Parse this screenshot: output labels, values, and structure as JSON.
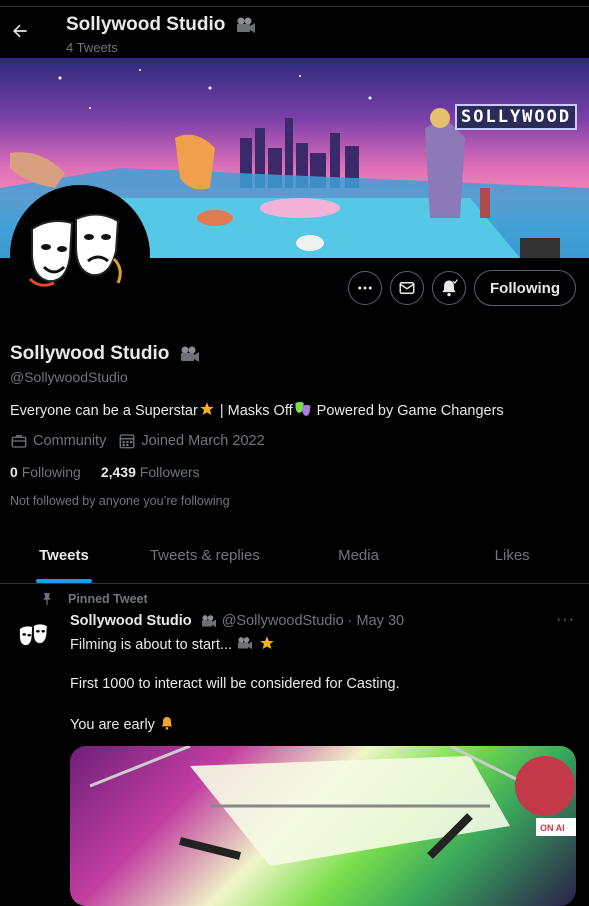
{
  "header": {
    "title": "Sollywood Studio",
    "tweet_count": "4 Tweets"
  },
  "banner": {
    "sign_text": "SOLLYWOOD"
  },
  "profile": {
    "name": "Sollywood Studio",
    "handle": "@SollywoodStudio",
    "bio_part1": "Everyone can be a Superstar",
    "bio_part2": " | Masks Off",
    "bio_part3": " Powered by Game Changers",
    "category": "Community",
    "joined": "Joined March 2022",
    "following_count": "0",
    "following_label": "Following",
    "followers_count": "2,439",
    "followers_label": "Followers",
    "note": "Not followed by anyone you’re following",
    "follow_button": "Following"
  },
  "tabs": [
    "Tweets",
    "Tweets & replies",
    "Media",
    "Likes"
  ],
  "tweet": {
    "pinned_label": "Pinned Tweet",
    "author": "Sollywood Studio",
    "handle": "@SollywoodStudio",
    "date": "· May 30",
    "line1": "Filming is about to start...",
    "line2": "First 1000 to interact will be considered for Casting.",
    "line3": "You are early"
  },
  "colors": {
    "accent": "#1d9bf0",
    "background": "#000000",
    "text": "#e7e9ea",
    "muted": "#71767b",
    "border": "#536471"
  },
  "icons": [
    "back-arrow-icon",
    "camera-icon",
    "more-icon",
    "mail-icon",
    "bell-icon",
    "briefcase-icon",
    "calendar-icon",
    "pin-icon",
    "star-icon",
    "mask-icon",
    "bell-emoji-icon"
  ]
}
